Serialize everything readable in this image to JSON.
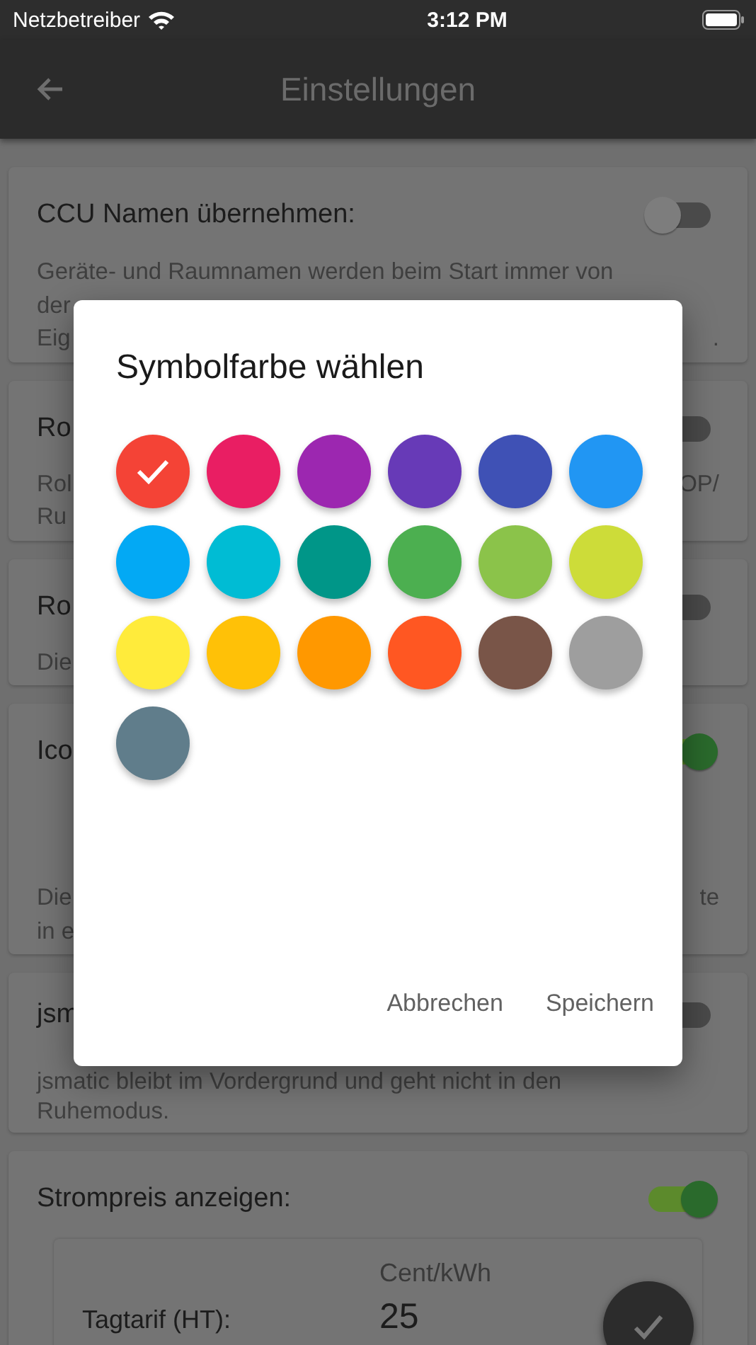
{
  "status_bar": {
    "carrier": "Netzbetreiber",
    "time": "3:12 PM"
  },
  "header": {
    "title": "Einstellungen"
  },
  "settings": [
    {
      "title": "CCU Namen übernehmen:",
      "on": false,
      "lines": [
        {
          "left": "Geräte- und Raumnamen werden beim Start immer von"
        },
        {
          "left": "der"
        },
        {
          "left": "Eig",
          "right": "."
        }
      ]
    },
    {
      "title": "Ro",
      "on": false,
      "lines": [
        {
          "left": "Rol",
          "right": "OP/"
        },
        {
          "left": "Ru"
        }
      ]
    },
    {
      "title": "Ro",
      "on": false,
      "lines": [
        {
          "left": "Die"
        }
      ]
    },
    {
      "title": "Ico",
      "on": true,
      "lines": [
        {
          "left": "Die",
          "right": "te"
        },
        {
          "left": "in e"
        }
      ]
    },
    {
      "title": "jsm",
      "on": false,
      "lines": [
        {
          "left": "jsmatic bleibt im Vordergrund und geht nicht in den"
        },
        {
          "left": "Ruhemodus."
        }
      ]
    }
  ],
  "price": {
    "title": "Strompreis anzeigen:",
    "on": true,
    "unit": "Cent/kWh",
    "label": "Tagtarif (HT):",
    "value": "25"
  },
  "dialog": {
    "title": "Symbolfarbe wählen",
    "colors": [
      {
        "color": "#f44336",
        "selected": true
      },
      {
        "color": "#e91e63",
        "selected": false
      },
      {
        "color": "#9c27b0",
        "selected": false
      },
      {
        "color": "#673ab7",
        "selected": false
      },
      {
        "color": "#3f51b5",
        "selected": false
      },
      {
        "color": "#2196f3",
        "selected": false
      },
      {
        "color": "#03a9f4",
        "selected": false
      },
      {
        "color": "#00bcd4",
        "selected": false
      },
      {
        "color": "#009688",
        "selected": false
      },
      {
        "color": "#4caf50",
        "selected": false
      },
      {
        "color": "#8bc34a",
        "selected": false
      },
      {
        "color": "#cddc39",
        "selected": false
      },
      {
        "color": "#ffeb3b",
        "selected": false
      },
      {
        "color": "#ffc107",
        "selected": false
      },
      {
        "color": "#ff9800",
        "selected": false
      },
      {
        "color": "#ff5722",
        "selected": false
      },
      {
        "color": "#795548",
        "selected": false
      },
      {
        "color": "#9e9e9e",
        "selected": false
      },
      {
        "color": "#607d8b",
        "selected": false
      }
    ],
    "buttons": [
      "Abbrechen",
      "Speichern"
    ]
  }
}
